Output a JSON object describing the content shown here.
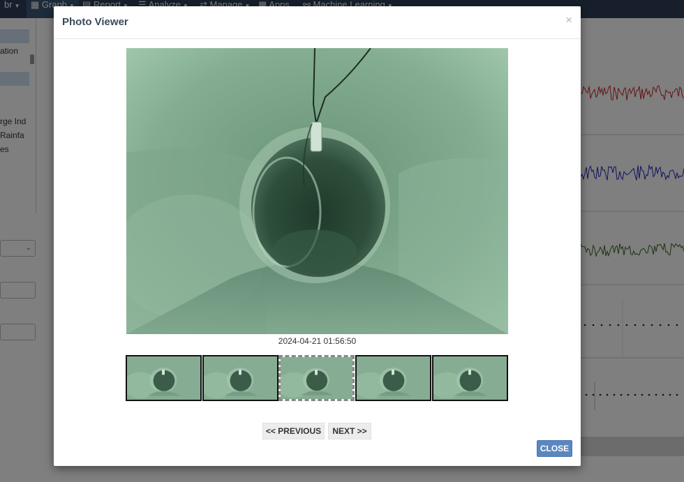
{
  "app": {
    "nav": [
      {
        "label": "br",
        "has_caret": true
      },
      {
        "label": "Graph",
        "has_caret": true
      },
      {
        "label": "Report",
        "has_caret": true
      },
      {
        "label": "Analyze",
        "has_caret": true
      },
      {
        "label": "Manage",
        "has_caret": true
      },
      {
        "label": "Apps",
        "has_caret": false
      },
      {
        "label": "Machine Learning",
        "has_caret": true
      }
    ],
    "sidebar_items": [
      "ation",
      "rge Ind",
      "Rainfa",
      "es"
    ],
    "series_colors": [
      "#cc2222",
      "#2222bb",
      "#336622"
    ]
  },
  "modal": {
    "title": "Photo Viewer",
    "close_symbol": "×",
    "timestamp": "2024-04-21 01:56:50",
    "thumbnail_count": 5,
    "selected_thumbnail": 3,
    "previous_label": "<< PREVIOUS",
    "next_label": "NEXT >>",
    "close_label": "CLOSE"
  }
}
